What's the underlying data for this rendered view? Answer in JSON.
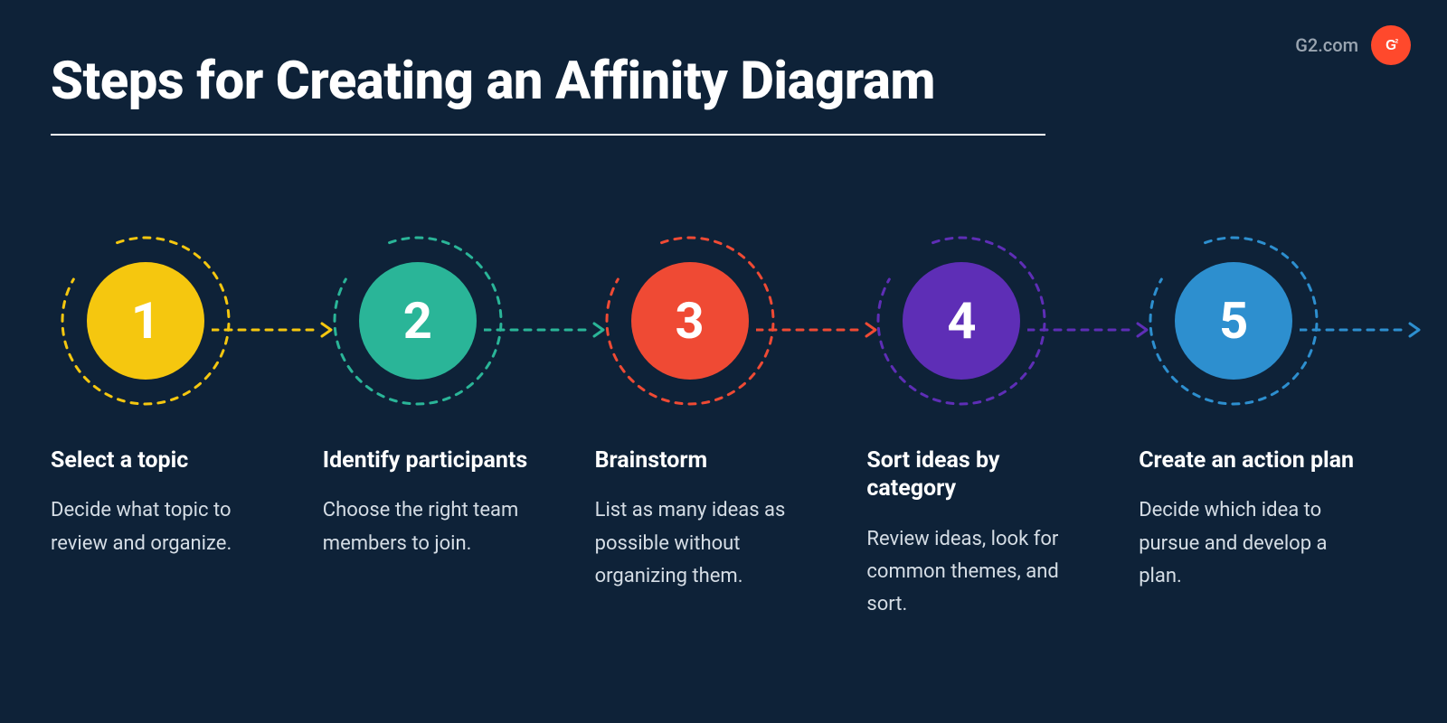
{
  "brand": {
    "label": "G2.com",
    "logo_text": "G"
  },
  "title": "Steps for Creating an Affinity Diagram",
  "colors": {
    "bg": "#0e2238",
    "accent": "#ff492c"
  },
  "steps": [
    {
      "num": "1",
      "color": "#f5c70f",
      "title": "Select a topic",
      "body": "Decide what topic to review and organize."
    },
    {
      "num": "2",
      "color": "#2ab598",
      "title": "Identify participants",
      "body": "Choose the right team members to join."
    },
    {
      "num": "3",
      "color": "#ef4a34",
      "title": "Brainstorm",
      "body": "List as many ideas as possible without organizing them."
    },
    {
      "num": "4",
      "color": "#5e2eb6",
      "title": "Sort ideas by category",
      "body": "Review ideas, look for common themes, and sort."
    },
    {
      "num": "5",
      "color": "#2d8fcf",
      "title": "Create an action plan",
      "body": "Decide which idea to pursue and develop a plan."
    }
  ]
}
